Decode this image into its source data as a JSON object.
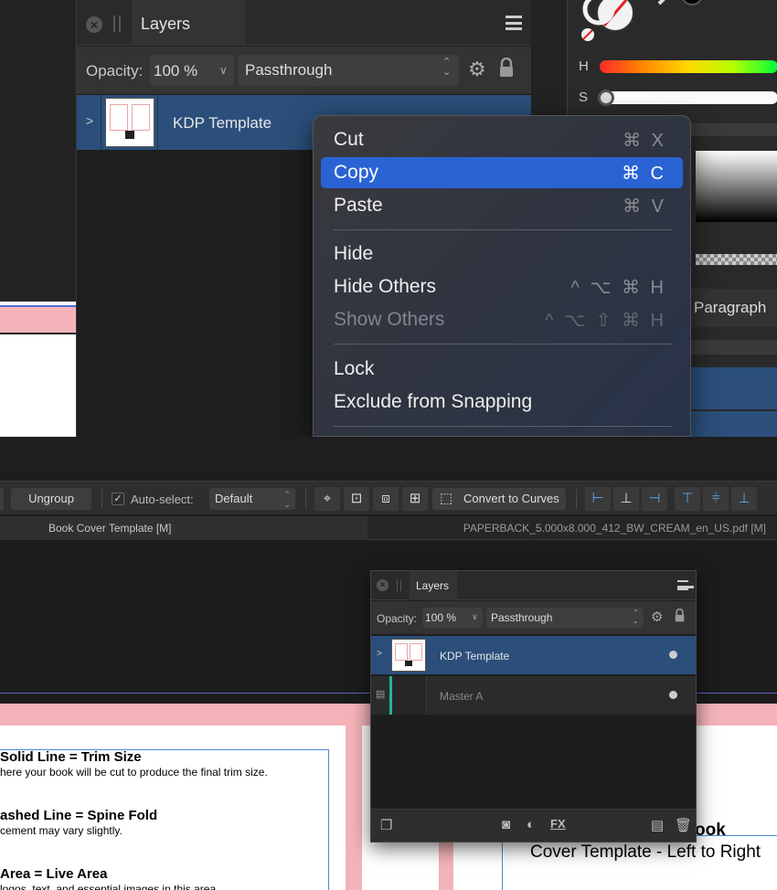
{
  "top_layers_panel": {
    "tab_label": "Layers",
    "opacity_label": "Opacity:",
    "opacity_value": "100 %",
    "blend_mode": "Passthrough",
    "layer_name": "KDP Template"
  },
  "context_menu": {
    "items": [
      {
        "label": "Cut",
        "shortcut": "⌘ X"
      },
      {
        "label": "Copy",
        "shortcut": "⌘ C"
      },
      {
        "label": "Paste",
        "shortcut": "⌘ V"
      },
      {
        "label": "Hide",
        "shortcut": ""
      },
      {
        "label": "Hide Others",
        "shortcut": "^ ⌥ ⌘ H"
      },
      {
        "label": "Show Others",
        "shortcut": "^ ⌥ ⇧ ⌘ H"
      },
      {
        "label": "Lock",
        "shortcut": ""
      },
      {
        "label": "Exclude from Snapping",
        "shortcut": ""
      }
    ],
    "selected_item": "Copy",
    "disabled_item": "Show Others"
  },
  "color_panel": {
    "h_label": "H",
    "s_label": "S",
    "paragraph_tab": "Paragraph",
    "accent_blue": "#2a63d4"
  },
  "toolbar": {
    "ungroup_label": "Ungroup",
    "autoselect_label": "Auto-select:",
    "autoselect_value": "Default",
    "convert_label": "Convert to Curves"
  },
  "doc_tabs": {
    "left": "Book Cover Template [M]",
    "right": "PAPERBACK_5.000x8.000_412_BW_CREAM_en_US.pdf [M]"
  },
  "bottom_layers_panel": {
    "tab_label": "Layers",
    "opacity_label": "Opacity:",
    "opacity_value": "100 %",
    "blend_mode": "Passthrough",
    "layers": [
      {
        "name": "KDP Template"
      },
      {
        "name": "Master A"
      }
    ]
  },
  "page_text": {
    "solid_heading": "Solid Line = Trim Size",
    "solid_body": "here your book will be cut to produce the final trim size.",
    "dashed_heading": "ashed Line = Spine Fold",
    "dashed_body": "cement may vary slightly.",
    "area_heading": "Area = Live Area",
    "area_body": "logos, text, and essential images in this area.",
    "right_heading": "ook",
    "right_body": "Cover Template - Left to Right"
  }
}
